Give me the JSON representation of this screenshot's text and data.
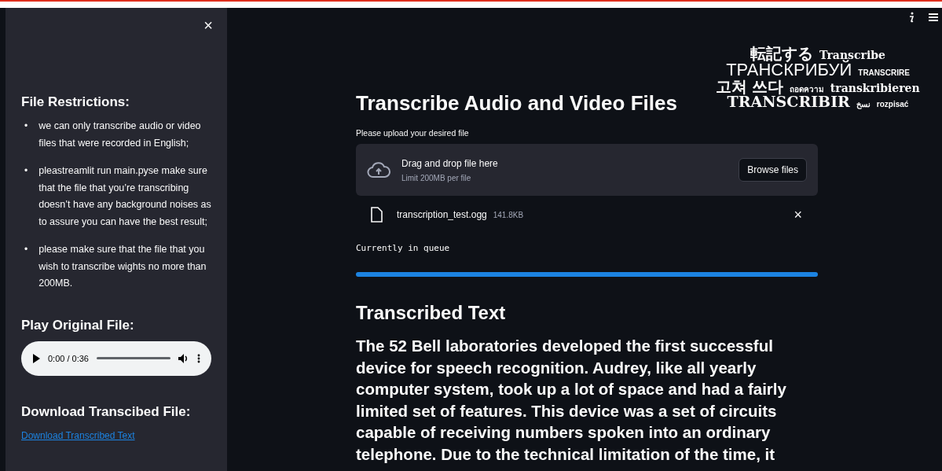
{
  "sidebar": {
    "close_label": "×",
    "restrictions_title": "File Restrictions:",
    "bullet": "•",
    "restrictions": [
      "we can only transcribe audio or video files that were recorded in English;",
      "pleastreamlit run main.pyse make sure that the file that you’re transcribing doesn’t have any background noises as to assure you can have the best result;",
      "please make sure that the file that you wish to transcribe wights no more than 200MB."
    ],
    "play_title": "Play Original File:",
    "player": {
      "time": "0:00 / 0:36",
      "level": 0
    },
    "download_title": "Download Transcibed File:",
    "download_link": "Download Transcribed Text"
  },
  "logo_words": [
    {
      "text": "転記する",
      "kind": "cjk"
    },
    {
      "text": "Transcribe",
      "kind": "serif"
    },
    {
      "text": "ТРАНСКРИБУЙ",
      "kind": "thin"
    },
    {
      "text": "TRANSCRIRE",
      "kind": "small"
    },
    {
      "text": "고쳐 쓰다",
      "kind": "cjk"
    },
    {
      "text": "ถอดความ",
      "kind": "small"
    },
    {
      "text": "transkribieren",
      "kind": "serif"
    },
    {
      "text": "TRANSCRIBIR",
      "kind": "big"
    },
    {
      "text": "نسخ",
      "kind": "small"
    },
    {
      "text": "rozpisać",
      "kind": "small"
    }
  ],
  "main": {
    "title": "Transcribe Audio and Video Files",
    "uploader": {
      "label": "Please upload your desired file",
      "drop_text": "Drag and drop file here",
      "limit": "Limit 200MB per file",
      "button": "Browse files"
    },
    "file": {
      "name": "transcription_test.ogg",
      "size": "141.8KB",
      "remove": "×"
    },
    "status": "Currently in queue",
    "progress": {
      "level": 1
    },
    "result_title": "Transcribed Text",
    "result": "The 52 Bell laboratories developed the first successful device for speech recognition. Audrey, like all yearly computer system, took up a lot of space and had a fairly limited set of features. This device was a set of circuits capable of receiving numbers spoken into an ordinary telephone. Due to the technical limitation of the time, it"
  }
}
